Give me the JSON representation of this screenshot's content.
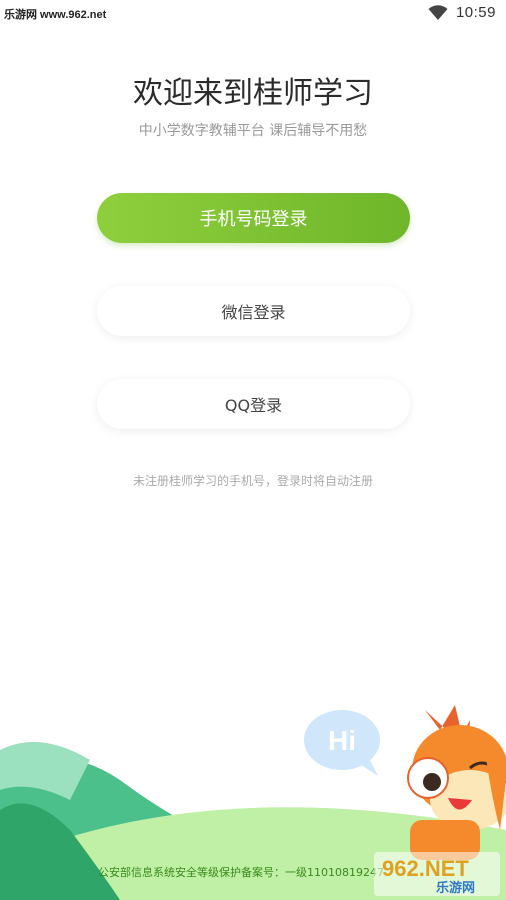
{
  "status_bar": {
    "watermark": "乐游网 www.962.net",
    "time": "10:59",
    "wifi_icon": "wifi-icon"
  },
  "header": {
    "title": "欢迎来到桂师学习",
    "subtitle": "中小学数字教辅平台  课后辅导不用愁"
  },
  "login": {
    "phone_label": "手机号码登录",
    "wechat_label": "微信登录",
    "qq_label": "QQ登录",
    "notice": "未注册桂师学习的手机号，登录时将自动注册"
  },
  "illustration": {
    "hi_bubble": "Hi",
    "mascot": "squirrel-mascot"
  },
  "footer": {
    "record_text": "公安部信息系统安全等级保护备案号：一级11010819247",
    "logo_text": "962.NET",
    "logo_sub": "乐游网"
  },
  "colors": {
    "primary": "#7cc232",
    "title": "#2b2b2b",
    "subtitle": "#9a9a9a"
  }
}
